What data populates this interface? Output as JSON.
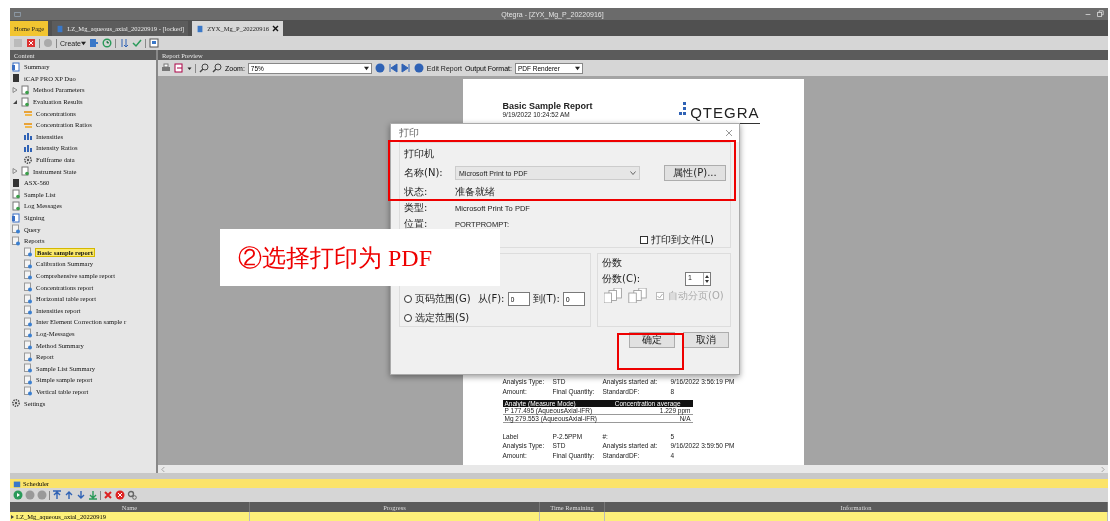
{
  "window": {
    "title": "Qtegra - [ZYX_Mg_P_20220916]"
  },
  "tabs": [
    {
      "label": "Home Page",
      "kind": "home",
      "selected": false,
      "closable": false
    },
    {
      "label": "LZ_Mg_aqueous_axial_20220919 - [locked]",
      "kind": "doc",
      "selected": false,
      "closable": false
    },
    {
      "label": "ZYX_Mg_P_20220916",
      "kind": "doc",
      "selected": true,
      "closable": true
    }
  ],
  "toolbar": {
    "create": "Create"
  },
  "content_panel": {
    "title": "Content",
    "tree": [
      {
        "label": "Summary",
        "kind": "summary",
        "selected": false
      },
      {
        "label": "iCAP PRO XP Duo",
        "kind": "device",
        "selected": false
      },
      {
        "label": "Method Parameters",
        "kind": "doc",
        "selected": false,
        "expanded": false
      },
      {
        "label": "Evaluation Results",
        "kind": "doc",
        "selected": false,
        "expanded": true,
        "children": [
          {
            "label": "Concentrations",
            "kind": "stack",
            "selected": false
          },
          {
            "label": "Concentration Ratios",
            "kind": "stack",
            "selected": false
          },
          {
            "label": "Intensities",
            "kind": "bars",
            "selected": false
          },
          {
            "label": "Intensity Ratios",
            "kind": "bars",
            "selected": false
          },
          {
            "label": "Fullframe data",
            "kind": "gear",
            "selected": false
          }
        ]
      },
      {
        "label": "Instrument State",
        "kind": "doc",
        "selected": false,
        "expanded": false
      },
      {
        "label": "ASX-560",
        "kind": "device",
        "selected": false
      },
      {
        "label": "Sample List",
        "kind": "doc",
        "selected": false
      },
      {
        "label": "Log Messages",
        "kind": "doc",
        "selected": false
      },
      {
        "label": "Signing",
        "kind": "summary",
        "selected": false
      },
      {
        "label": "Query",
        "kind": "report",
        "selected": false
      },
      {
        "label": "Reports",
        "kind": "report",
        "selected": false,
        "children": [
          {
            "label": "Basic sample report",
            "kind": "report",
            "selected": true
          },
          {
            "label": "Calibration Summary",
            "kind": "report",
            "selected": false
          },
          {
            "label": "Comprehensive sample report",
            "kind": "report",
            "selected": false
          },
          {
            "label": "Concentrations report",
            "kind": "report",
            "selected": false
          },
          {
            "label": "Horizontal table report",
            "kind": "report",
            "selected": false
          },
          {
            "label": "Intensities report",
            "kind": "report",
            "selected": false
          },
          {
            "label": "Inter Element Correction sample r",
            "kind": "report",
            "selected": false
          },
          {
            "label": "Log-Messages",
            "kind": "report",
            "selected": false
          },
          {
            "label": "Method Summary",
            "kind": "report",
            "selected": false
          },
          {
            "label": "Report",
            "kind": "report",
            "selected": false
          },
          {
            "label": "Sample List Summary",
            "kind": "report",
            "selected": false
          },
          {
            "label": "Simple sample report",
            "kind": "report",
            "selected": false
          },
          {
            "label": "Vertical table report",
            "kind": "report",
            "selected": false
          }
        ]
      },
      {
        "label": "Settings",
        "kind": "gear",
        "selected": false
      }
    ]
  },
  "preview": {
    "title": "Report Preview",
    "zoom_label": "Zoom:",
    "zoom": "75%",
    "edit_report": "Edit Report",
    "format_label": "Output Format:",
    "format": "PDF Renderer",
    "page": {
      "title": "Basic Sample Report",
      "date": "9/19/2022 10:24:52 AM",
      "logo": "QTEGRA",
      "blocks": [
        {
          "lines": [
            [
              "Analysis Type:",
              "STD",
              "Analysis started at:",
              "9/16/2022 3:56:19 PM"
            ],
            [
              "Amount:",
              "Final Quantity:",
              "StandardDF:",
              "8"
            ]
          ],
          "table": {
            "columns": [
              "Analyte (Measure Mode)",
              "Concentration average"
            ],
            "rows": [
              [
                "P 177.495 (AqueousAxial-iFR)",
                "1.229 ppm"
              ],
              [
                "Mg 279.553 (AqueousAxial-iFR)",
                "N/A"
              ]
            ]
          }
        },
        {
          "lines": [
            [
              "Label",
              "P-2.5PPM",
              "#:",
              "5"
            ],
            [
              "Analysis Type:",
              "STD",
              "Analysis started at:",
              "9/16/2022 3:59:50 PM"
            ],
            [
              "Amount:",
              "Final Quantity:",
              "StandardDF:",
              "4"
            ]
          ]
        }
      ]
    }
  },
  "print_dialog": {
    "title": "打印",
    "printer_group": "打印机",
    "name_label": "名称(N):",
    "printer": "Microsoft Print to PDF",
    "properties_button": "属性(P)...",
    "info": [
      {
        "label": "状态:",
        "value": "准备就绪"
      },
      {
        "label": "类型:",
        "value": "Microsoft Print To PDF"
      },
      {
        "label": "位置:",
        "value": "PORTPROMPT:"
      }
    ],
    "print_to_file": {
      "label": "打印到文件(L)",
      "checked": false
    },
    "ranges": [
      {
        "label": "页码范围(G)",
        "selected": false
      },
      {
        "label": "选定范围(S)",
        "selected": false
      }
    ],
    "from_label": "从(F):",
    "from": "0",
    "to_label": "到(T):",
    "to": "0",
    "copies_group": "份数",
    "copies_label": "份数(C):",
    "copies": "1",
    "collate": {
      "label": "自动分页(O)",
      "checked": true,
      "disabled": true
    },
    "ok": "确定",
    "cancel": "取消"
  },
  "callout": {
    "text": "②选择打印为 PDF"
  },
  "scheduler": {
    "title": "Scheduler",
    "columns": [
      "Name",
      "Progress",
      "Time Remaining",
      "Information"
    ],
    "rows": [
      {
        "name": "LZ_Mg_aqueous_axial_20220919",
        "selected": true
      }
    ]
  }
}
